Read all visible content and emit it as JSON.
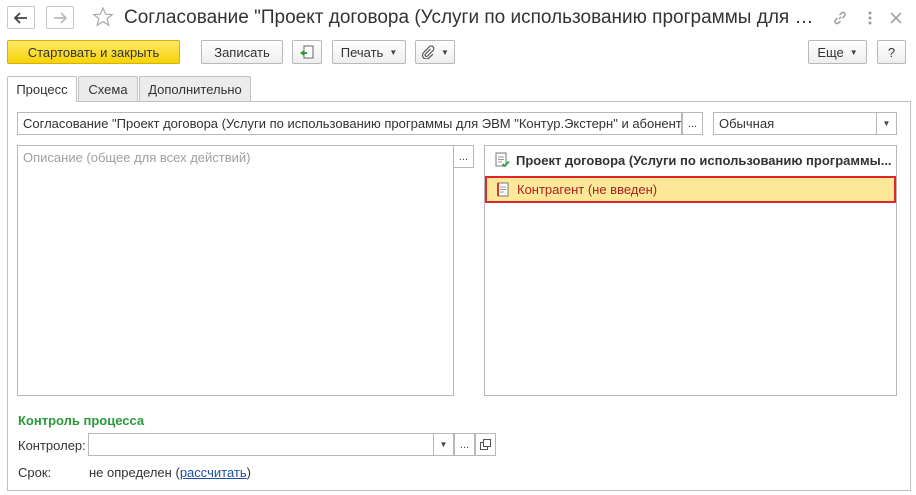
{
  "window": {
    "title": "Согласование \"Проект договора (Услуги по использованию программы для ЭВМ \"Контур.Экстерн\" и абонентс..."
  },
  "toolbar": {
    "start_close": "Стартовать и закрыть",
    "save": "Записать",
    "print": "Печать",
    "more": "Еще",
    "help": "?"
  },
  "tabs": [
    {
      "label": "Процесс"
    },
    {
      "label": "Схема"
    },
    {
      "label": "Дополнительно"
    }
  ],
  "process": {
    "name_value": "Согласование \"Проект договора (Услуги по использованию программы для ЭВМ \"Контур.Экстерн\" и абонентс",
    "priority_value": "Обычная",
    "description_placeholder": "Описание (общее для всех действий)"
  },
  "tree": {
    "items": [
      {
        "label": "Проект договора (Услуги по использованию программы..."
      },
      {
        "label": "Контрагент (не введен)"
      }
    ]
  },
  "control": {
    "section_title": "Контроль процесса",
    "controller_label": "Контролер:",
    "controller_value": "",
    "deadline_label": "Срок:",
    "deadline_value": "не определен",
    "deadline_paren_open": "(",
    "deadline_link": "рассчитать",
    "deadline_paren_close": ")"
  },
  "colors": {
    "accent_yellow": "#f6d30a",
    "highlight_row": "#fbe999",
    "highlight_border": "#e0262b",
    "link_blue": "#1c4fa1",
    "section_green": "#2a9a3a"
  }
}
